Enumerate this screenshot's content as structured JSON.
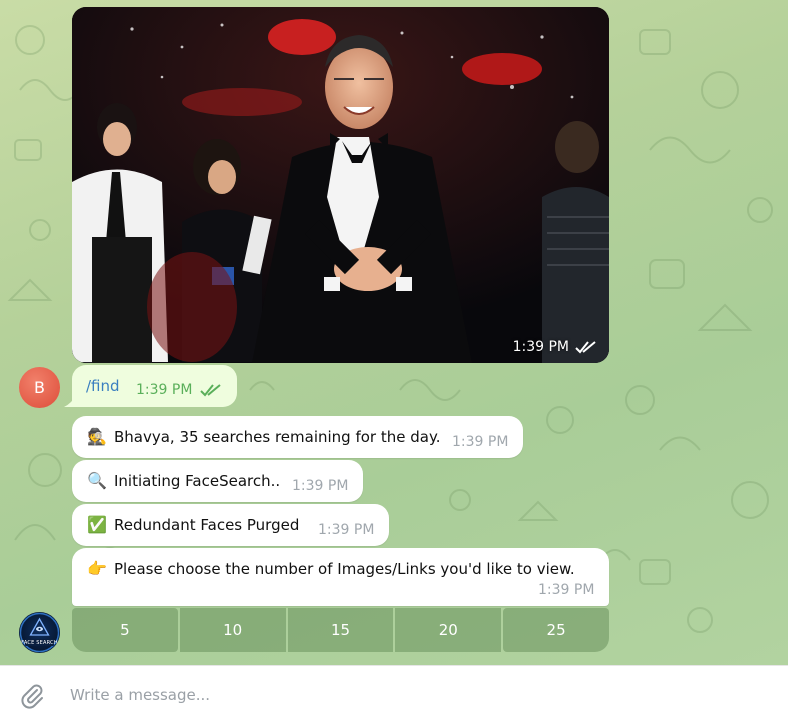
{
  "photo_message": {
    "time": "1:39 PM",
    "status_icon": "double-check-icon"
  },
  "user_avatar": {
    "initial": "B",
    "color": "#e4563f"
  },
  "command_message": {
    "text": "/find",
    "time": "1:39 PM",
    "status_icon": "double-check-icon"
  },
  "bot_messages": [
    {
      "emoji": "🕵",
      "text": "Bhavya, 35 searches remaining for the day.",
      "time": "1:39 PM"
    },
    {
      "emoji": "🔍",
      "text": "Initiating FaceSearch..",
      "time": "1:39 PM"
    },
    {
      "emoji": "✅",
      "text": "Redundant Faces Purged",
      "time": "1:39 PM"
    },
    {
      "emoji": "👉",
      "text": "Please choose the number of Images/Links you'd like to view.",
      "time": "1:39 PM"
    }
  ],
  "keyboard_buttons": [
    "5",
    "10",
    "15",
    "20",
    "25"
  ],
  "bot_avatar": {
    "label": "FACE SEARCH"
  },
  "composer": {
    "placeholder": "Write a message...",
    "attach_icon": "paperclip-icon"
  },
  "colors": {
    "outgoing_bubble": "#effdde",
    "incoming_bubble": "#ffffff",
    "link": "#3a7fc0",
    "check": "#5aaf5a"
  }
}
